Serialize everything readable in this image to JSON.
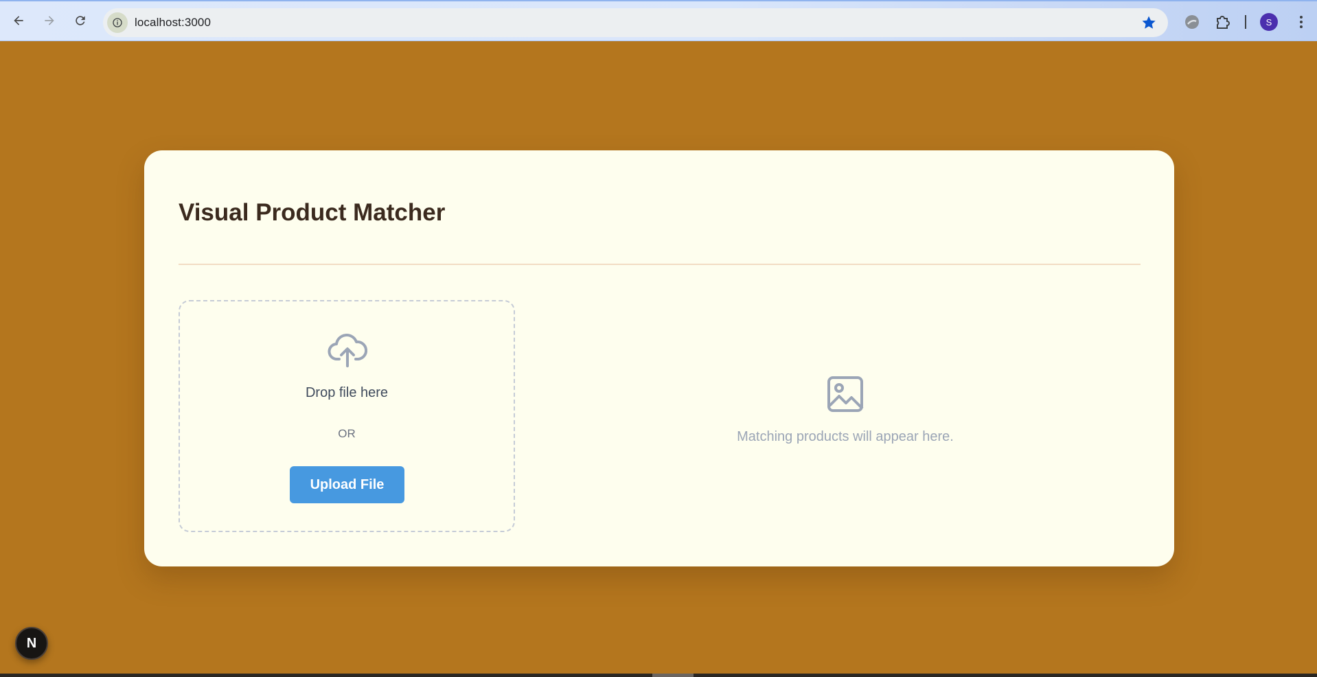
{
  "browser": {
    "url": "localhost:3000",
    "profile_initial": "S",
    "icons": {
      "back": "arrow-left-icon",
      "forward": "arrow-right-icon",
      "reload": "reload-icon",
      "site_info": "info-icon",
      "bookmark": "star-icon",
      "extension_1": "blocked-circle-icon",
      "extensions": "puzzle-icon",
      "menu": "kebab-menu-icon"
    },
    "colors": {
      "bookmark_star": "#0b57d0",
      "avatar": "#4b2fae"
    }
  },
  "page": {
    "background": "#b4761e",
    "title": "Visual Product Matcher",
    "upload": {
      "icon": "cloud-upload-icon",
      "drop_text": "Drop file here",
      "or_text": "OR",
      "button_label": "Upload File",
      "button_color": "#4799e0"
    },
    "results": {
      "icon": "image-placeholder-icon",
      "empty_text": "Matching products will appear here."
    }
  },
  "dev_badge": {
    "label": "N",
    "icon": "nextjs-logo-icon"
  }
}
